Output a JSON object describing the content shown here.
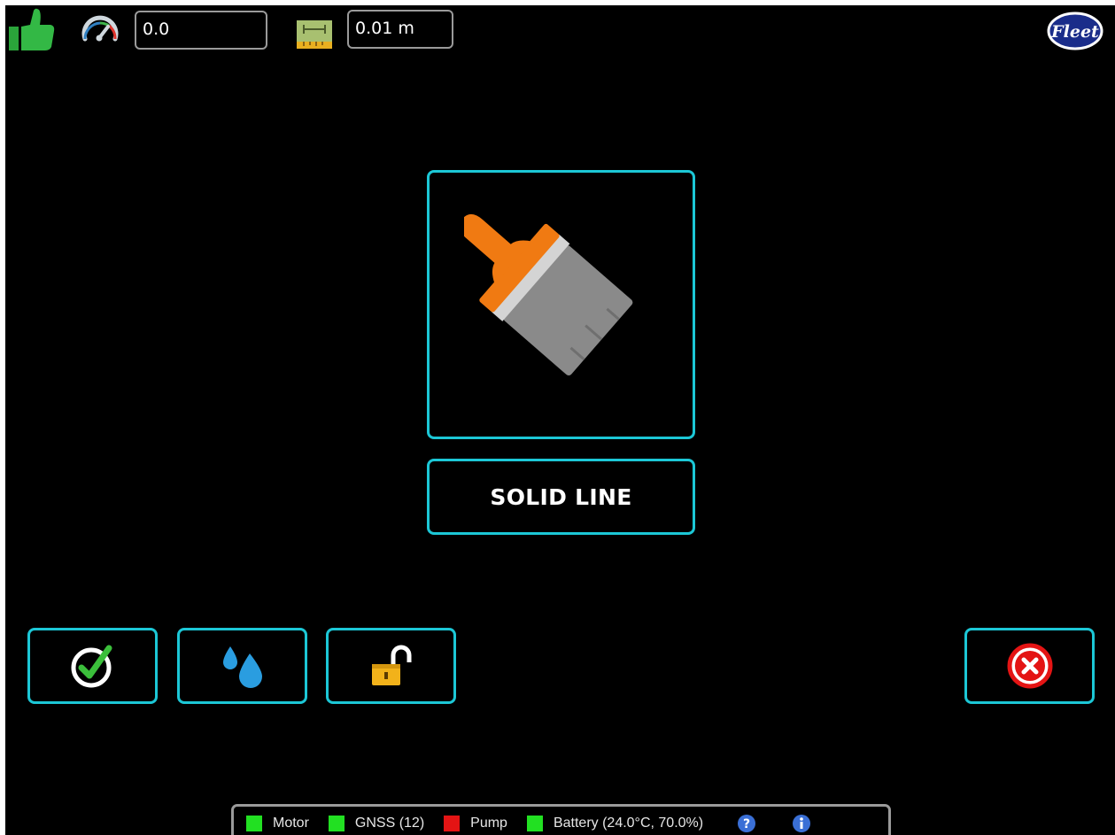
{
  "top_bar": {
    "status_icon": "thumbs-up-icon",
    "speed_icon": "speedometer-icon",
    "speed_value": "0.0",
    "distance_icon": "ruler-icon",
    "distance_value": "0.01 m",
    "logo_text": "Fleet"
  },
  "main": {
    "mode_icon": "paintbrush-icon",
    "mode_label": "SOLID LINE"
  },
  "actions": [
    {
      "icon": "check-circle-icon"
    },
    {
      "icon": "water-drops-icon"
    },
    {
      "icon": "unlocked-padlock-icon"
    },
    {
      "icon": "cancel-x-icon"
    }
  ],
  "status_bar": {
    "items": [
      {
        "label": "Motor",
        "color": "#22e022"
      },
      {
        "label": "GNSS (12)",
        "color": "#22e022"
      },
      {
        "label": "Pump",
        "color": "#e41414"
      },
      {
        "label": "Battery (24.0°C, 70.0%)",
        "color": "#22e022"
      }
    ],
    "help_icon": "help-icon",
    "info_icon": "info-icon"
  },
  "colors": {
    "accent": "#1cc7d6",
    "background": "#000000",
    "ok": "#22e022",
    "error": "#e41414",
    "brush_handle": "#f07a12"
  }
}
